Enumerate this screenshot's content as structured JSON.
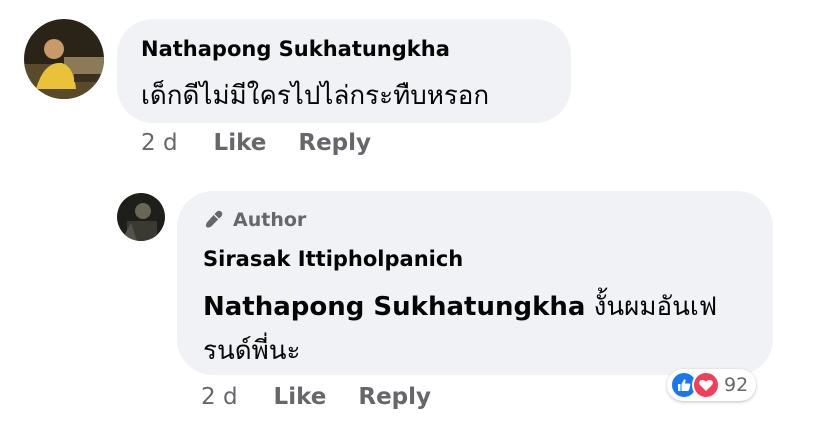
{
  "comment": {
    "author_name": "Nathapong Sukhatungkha",
    "text": "เด็กดีไม่มีใครไปไล่กระทืบหรอก",
    "time": "2 d",
    "like_label": "Like",
    "reply_label": "Reply"
  },
  "reply": {
    "author_badge": "Author",
    "author_name": "Sirasak Ittipholpanich",
    "mention": "Nathapong Sukhatungkha",
    "text_line1": " งั้นผมอันเฟ",
    "text_line2": "รนด์พี่นะ",
    "time": "2 d",
    "like_label": "Like",
    "reply_label": "Reply",
    "reaction_count": "92",
    "reactions": [
      "like-icon",
      "love-icon"
    ]
  },
  "colors": {
    "bubble": "#f0f2f5",
    "like_blue": "#1877f2",
    "love_red": "#f33e58",
    "meta_gray": "#65676b"
  }
}
